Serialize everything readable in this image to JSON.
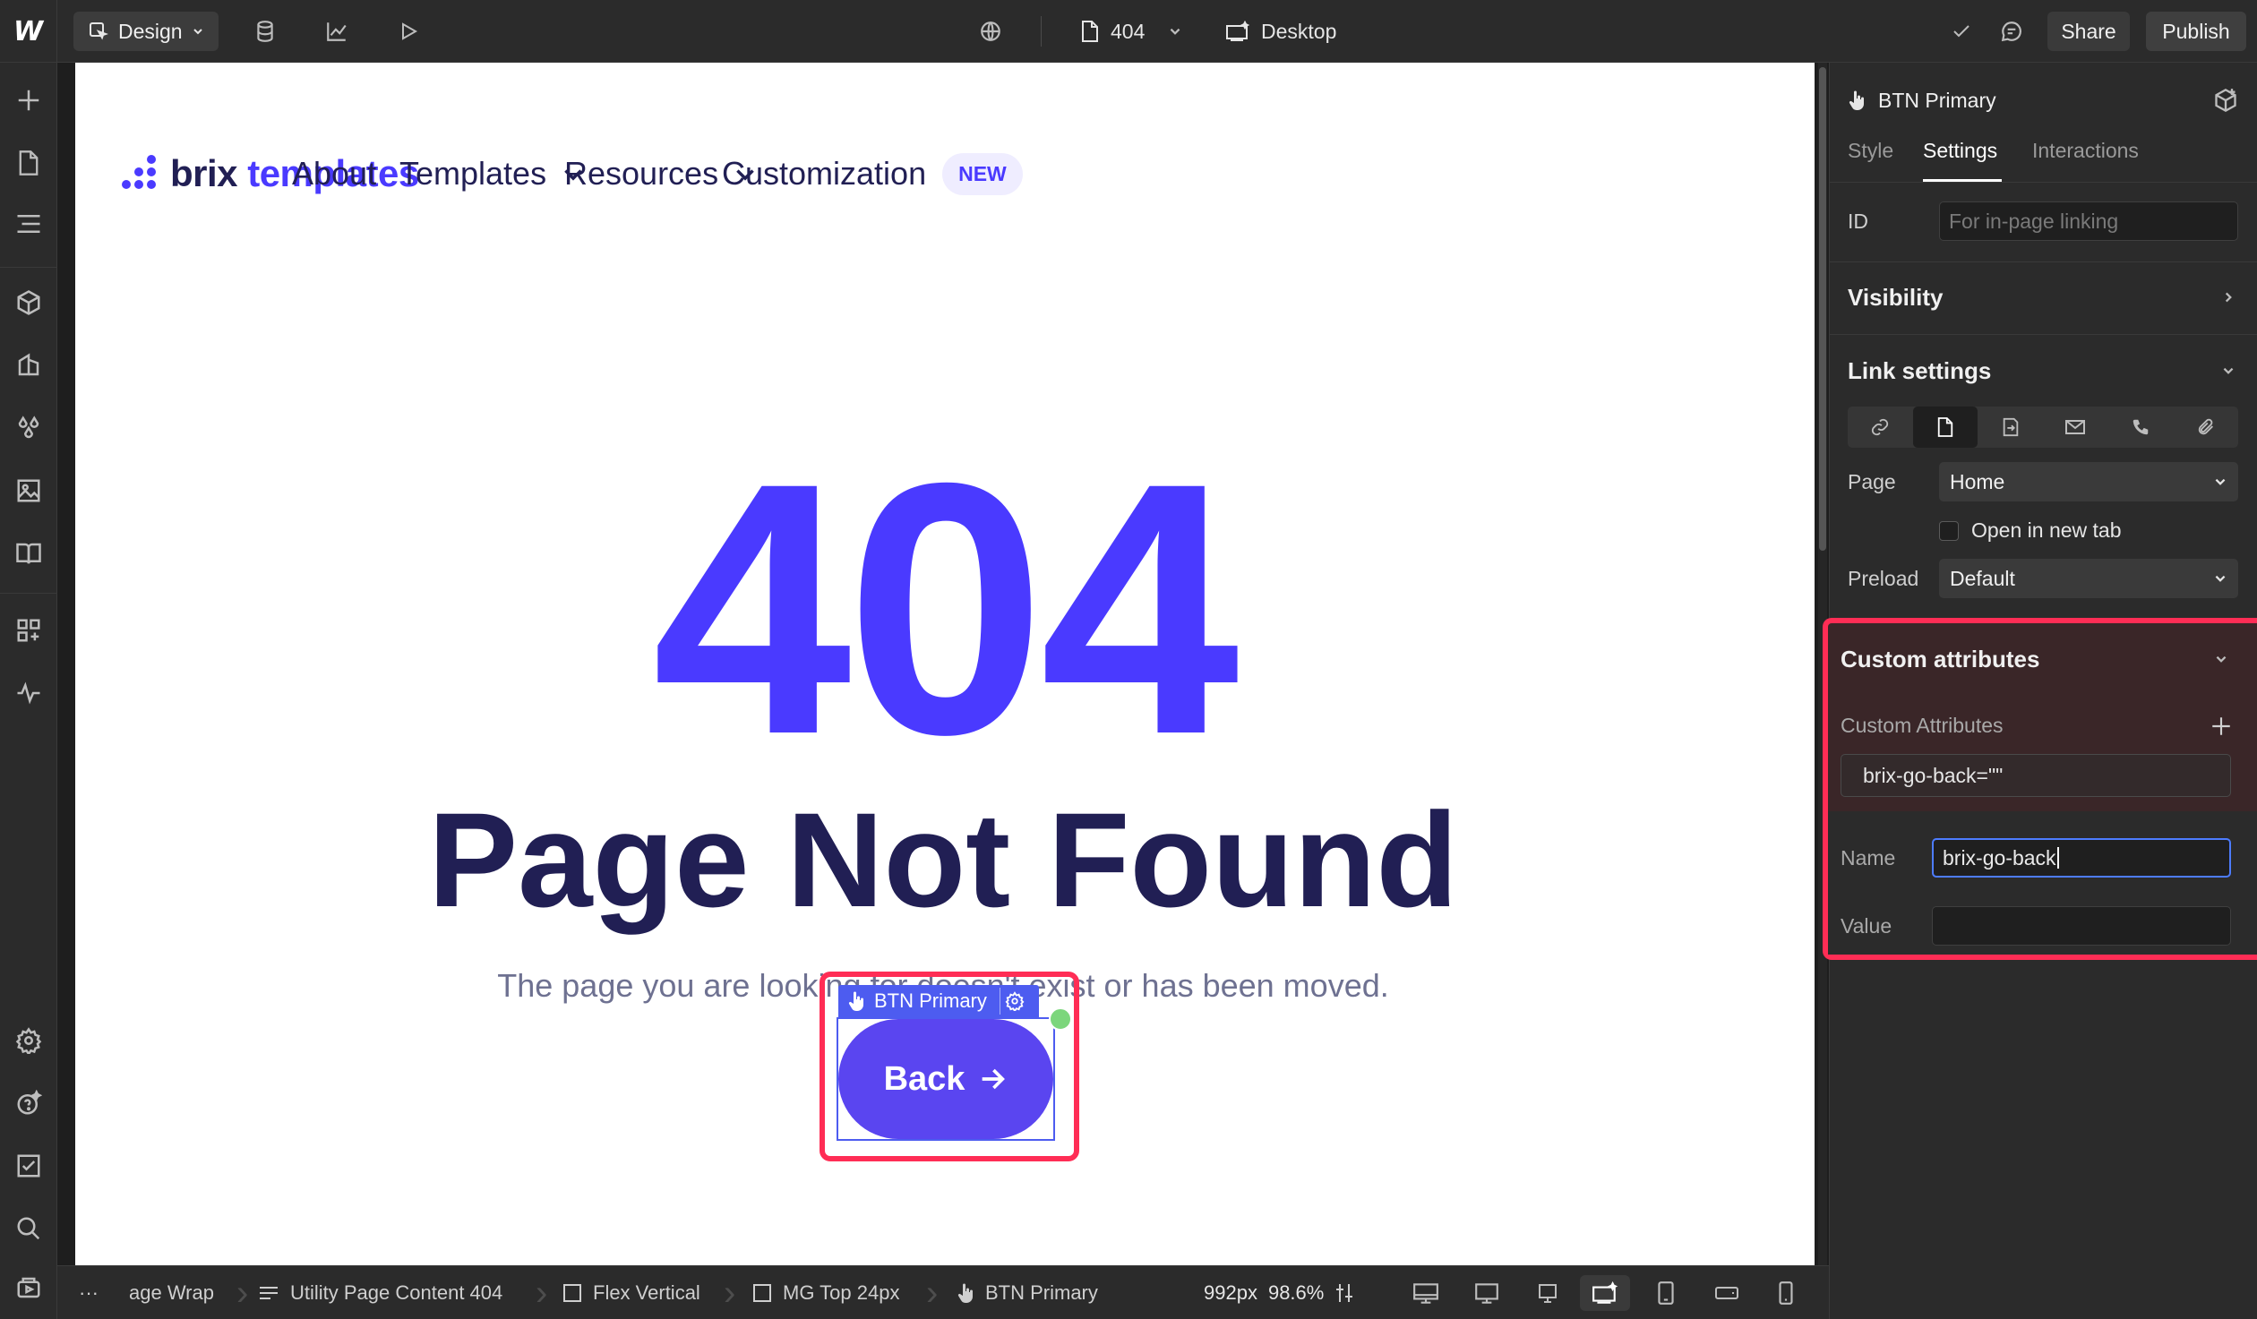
{
  "topbar": {
    "mode_label": "Design",
    "page_name": "404",
    "breakpoint_label": "Desktop",
    "share_label": "Share",
    "publish_label": "Publish"
  },
  "site": {
    "logo_brix": "brix",
    "logo_templates": "templates",
    "nav": {
      "about": "About",
      "templates": "Templates",
      "resources": "Resources",
      "customization": "Customization",
      "new_badge": "NEW"
    },
    "error_code": "404",
    "headline": "Page Not Found",
    "subtitle": "The page you are looking for doesn't exist or has been moved.",
    "button_tag": "BTN Primary",
    "button_label": "Back"
  },
  "bottombar": {
    "more": "···",
    "crumbs": [
      "age Wrap",
      "Utility Page Content 404",
      "Flex Vertical",
      "MG Top 24px",
      "BTN Primary"
    ],
    "width_readout": "992px",
    "zoom_readout": "98.6%"
  },
  "panel": {
    "element_name": "BTN Primary",
    "tabs": {
      "style": "Style",
      "settings": "Settings",
      "interactions": "Interactions"
    },
    "id_label": "ID",
    "id_placeholder": "For in-page linking",
    "visibility_title": "Visibility",
    "link_settings_title": "Link settings",
    "page_label": "Page",
    "page_value": "Home",
    "open_new_tab_label": "Open in new tab",
    "preload_label": "Preload",
    "preload_value": "Default",
    "custom_attributes_title": "Custom attributes",
    "custom_attributes_subtitle": "Custom Attributes",
    "attribute_entry": "brix-go-back=\"\"",
    "name_label": "Name",
    "name_value": "brix-go-back",
    "value_label": "Value",
    "value_value": ""
  },
  "colors": {
    "accent_purple": "#4a3aff",
    "navy_text": "#211f54",
    "highlight_red": "#ff2d55",
    "selection_blue": "#4d5cf0"
  }
}
